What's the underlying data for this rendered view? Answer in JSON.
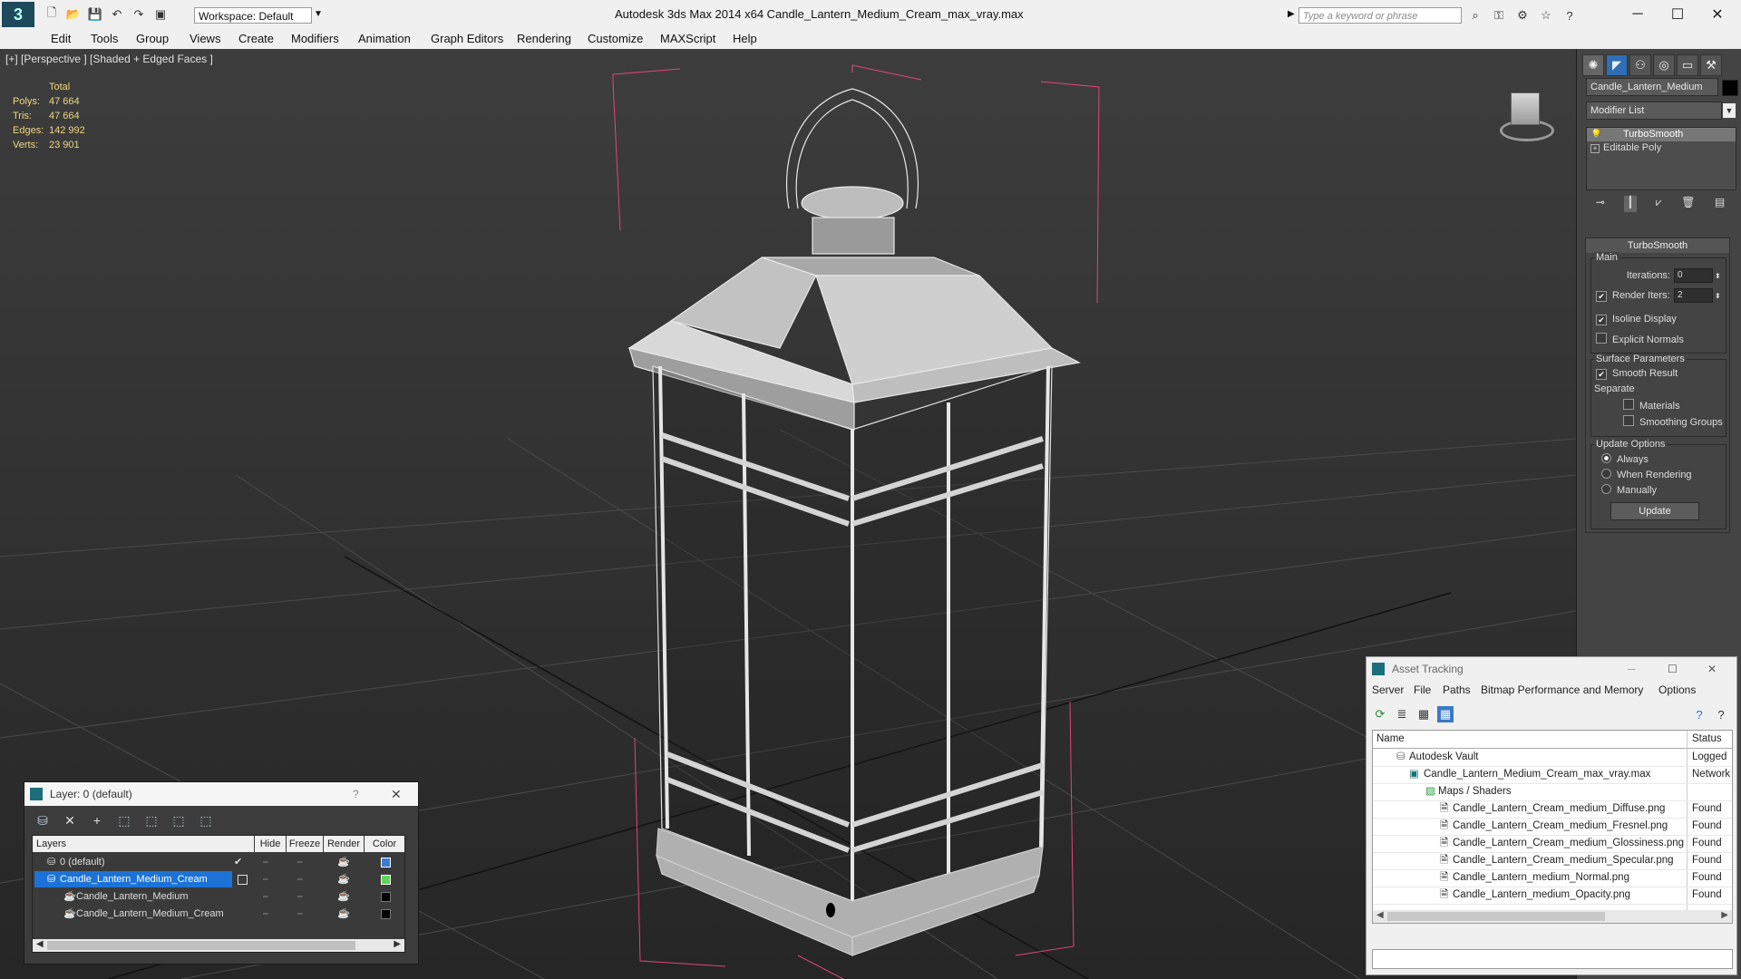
{
  "titlebar": {
    "workspace": "Workspace: Default",
    "title": "Autodesk 3ds Max  2014 x64       Candle_Lantern_Medium_Cream_max_vray.max",
    "search_placeholder": "Type a keyword or phrase"
  },
  "menubar": [
    "Edit",
    "Tools",
    "Group",
    "Views",
    "Create",
    "Modifiers",
    "Animation",
    "Graph Editors",
    "Rendering",
    "Customize",
    "MAXScript",
    "Help"
  ],
  "viewport": {
    "label": "[+] [Perspective ] [Shaded + Edged Faces ]",
    "stats": {
      "header": "Total",
      "rows": [
        {
          "label": "Polys:",
          "value": "47 664"
        },
        {
          "label": "Tris:",
          "value": "47 664"
        },
        {
          "label": "Edges:",
          "value": "142 992"
        },
        {
          "label": "Verts:",
          "value": "23 901"
        }
      ]
    }
  },
  "command_panel": {
    "object_name": "Candle_Lantern_Medium",
    "modifier_list": "Modifier List",
    "stack": [
      "TurboSmooth",
      "Editable Poly"
    ],
    "turbosmooth": {
      "title": "TurboSmooth",
      "main": "Main",
      "iterations_label": "Iterations:",
      "iterations_value": "0",
      "render_iters_label": "Render Iters:",
      "render_iters_value": "2",
      "isoline": "Isoline Display",
      "explicit_normals": "Explicit Normals",
      "surface_params": "Surface Parameters",
      "smooth_result": "Smooth Result",
      "separate": "Separate",
      "materials": "Materials",
      "smoothing_groups": "Smoothing Groups",
      "update_options": "Update Options",
      "always": "Always",
      "when_rendering": "When Rendering",
      "manually": "Manually",
      "update_button": "Update"
    }
  },
  "layer_dialog": {
    "title": "Layer: 0 (default)",
    "help": "?",
    "columns": [
      "Layers",
      "Hide",
      "Freeze",
      "Render",
      "Color"
    ],
    "rows": [
      {
        "name": "0 (default)",
        "color": "#3a7bd5"
      },
      {
        "name": "Candle_Lantern_Medium_Cream",
        "color": "#5fd35a"
      },
      {
        "name": "Candle_Lantern_Medium",
        "color": "#000000"
      },
      {
        "name": "Candle_Lantern_Medium_Cream",
        "color": "#000000"
      }
    ]
  },
  "asset_dialog": {
    "title": "Asset Tracking",
    "menu": [
      "Server",
      "File",
      "Paths",
      "Bitmap Performance and Memory",
      "Options"
    ],
    "columns": [
      "Name",
      "Status"
    ],
    "rows": [
      {
        "name": "Autodesk Vault",
        "status": "Logged"
      },
      {
        "name": "Candle_Lantern_Medium_Cream_max_vray.max",
        "status": "Network"
      },
      {
        "name": "Maps / Shaders",
        "status": ""
      },
      {
        "name": "Candle_Lantern_Cream_medium_Diffuse.png",
        "status": "Found"
      },
      {
        "name": "Candle_Lantern_Cream_medium_Fresnel.png",
        "status": "Found"
      },
      {
        "name": "Candle_Lantern_Cream_medium_Glossiness.png",
        "status": "Found"
      },
      {
        "name": "Candle_Lantern_Cream_medium_Specular.png",
        "status": "Found"
      },
      {
        "name": "Candle_Lantern_medium_Normal.png",
        "status": "Found"
      },
      {
        "name": "Candle_Lantern_medium_Opacity.png",
        "status": "Found"
      }
    ]
  }
}
